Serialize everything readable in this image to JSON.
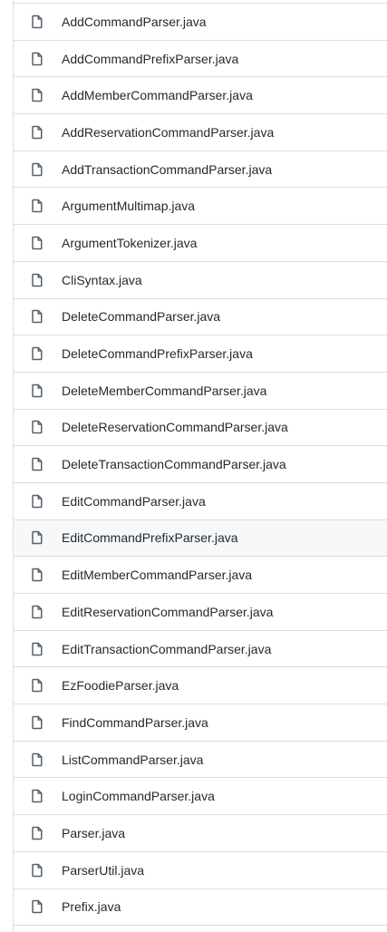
{
  "files": [
    {
      "name": "AddCommandParser.java",
      "icon": "file-icon"
    },
    {
      "name": "AddCommandPrefixParser.java",
      "icon": "file-icon"
    },
    {
      "name": "AddMemberCommandParser.java",
      "icon": "file-icon"
    },
    {
      "name": "AddReservationCommandParser.java",
      "icon": "file-icon"
    },
    {
      "name": "AddTransactionCommandParser.java",
      "icon": "file-icon"
    },
    {
      "name": "ArgumentMultimap.java",
      "icon": "file-icon"
    },
    {
      "name": "ArgumentTokenizer.java",
      "icon": "file-icon"
    },
    {
      "name": "CliSyntax.java",
      "icon": "file-icon"
    },
    {
      "name": "DeleteCommandParser.java",
      "icon": "file-icon"
    },
    {
      "name": "DeleteCommandPrefixParser.java",
      "icon": "file-icon"
    },
    {
      "name": "DeleteMemberCommandParser.java",
      "icon": "file-icon"
    },
    {
      "name": "DeleteReservationCommandParser.java",
      "icon": "file-icon"
    },
    {
      "name": "DeleteTransactionCommandParser.java",
      "icon": "file-icon"
    },
    {
      "name": "EditCommandParser.java",
      "icon": "file-icon"
    },
    {
      "name": "EditCommandPrefixParser.java",
      "icon": "file-icon",
      "hovered": true
    },
    {
      "name": "EditMemberCommandParser.java",
      "icon": "file-icon"
    },
    {
      "name": "EditReservationCommandParser.java",
      "icon": "file-icon"
    },
    {
      "name": "EditTransactionCommandParser.java",
      "icon": "file-icon"
    },
    {
      "name": "EzFoodieParser.java",
      "icon": "file-icon"
    },
    {
      "name": "FindCommandParser.java",
      "icon": "file-icon"
    },
    {
      "name": "ListCommandParser.java",
      "icon": "file-icon"
    },
    {
      "name": "LoginCommandParser.java",
      "icon": "file-icon"
    },
    {
      "name": "Parser.java",
      "icon": "file-icon"
    },
    {
      "name": "ParserUtil.java",
      "icon": "file-icon"
    },
    {
      "name": "Prefix.java",
      "icon": "file-icon"
    }
  ],
  "colors": {
    "text": "#24292f",
    "icon": "#57606a",
    "border": "#d8dee4",
    "hover_bg": "#f6f8fa"
  }
}
